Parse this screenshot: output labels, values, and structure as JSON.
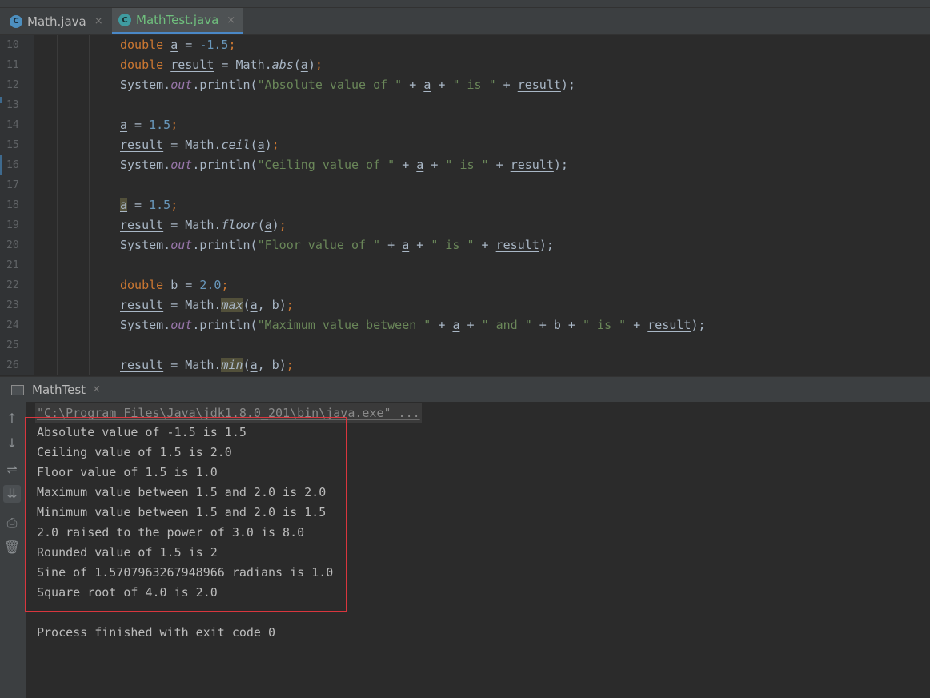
{
  "tabs": [
    {
      "label": "Math.java",
      "icon": "class-icon"
    },
    {
      "label": "MathTest.java",
      "icon": "class-icon"
    }
  ],
  "close_glyph": "×",
  "editor": {
    "line_numbers": [
      "10",
      "11",
      "12",
      "13",
      "14",
      "15",
      "16",
      "17",
      "18",
      "19",
      "20",
      "21",
      "22",
      "23",
      "24",
      "25",
      "26"
    ],
    "tokens": {
      "double": "double",
      "a": "a",
      "result": "result",
      "b": "b",
      "system": "System.",
      "out": "out",
      "println": ".println(",
      "math": "Math.",
      "abs": "abs",
      "ceil": "ceil",
      "floor": "floor",
      "max": "max",
      "min": "min",
      "eq": " = ",
      "plus": " + ",
      "semi": ";",
      "open": "(",
      "close": ")",
      "close_semi": ");",
      "comma_b": ", b",
      "neg15": "-1.5",
      "v15": "1.5",
      "v20": "2.0",
      "s_abs": "\"Absolute value of \"",
      "s_ceil": "\"Ceiling value of \"",
      "s_floor": "\"Floor value of \"",
      "s_max": "\"Maximum value between \"",
      "s_and": "\" and \"",
      "s_is": "\" is \""
    }
  },
  "run": {
    "tab_label": "MathTest",
    "command": "\"C:\\Program Files\\Java\\jdk1.8.0_201\\bin\\java.exe\" ...",
    "output": [
      "Absolute value of -1.5 is 1.5",
      "Ceiling value of 1.5 is 2.0",
      "Floor value of 1.5 is 1.0",
      "Maximum value between 1.5 and 2.0 is 2.0",
      "Minimum value between 1.5 and 2.0 is 1.5",
      "2.0 raised to the power of 3.0 is 8.0",
      "Rounded value of 1.5 is 2",
      "Sine of 1.5707963267948966 radians is 1.0",
      "Square root of 4.0 is 2.0"
    ],
    "exit": "Process finished with exit code 0",
    "toolbar": [
      {
        "name": "up-arrow-icon",
        "glyph": "↑"
      },
      {
        "name": "down-arrow-icon",
        "glyph": "↓"
      },
      {
        "name": "soft-wrap-icon",
        "glyph": "⇌"
      },
      {
        "name": "scroll-to-end-icon",
        "glyph": "⇊"
      },
      {
        "name": "print-icon",
        "glyph": "⎙"
      },
      {
        "name": "trash-icon",
        "glyph": "🗑"
      }
    ]
  },
  "colors": {
    "keyword": "#cc7832",
    "number": "#6897bb",
    "string": "#6a8759",
    "field": "#9876aa",
    "highlight_box": "#d9363e"
  }
}
